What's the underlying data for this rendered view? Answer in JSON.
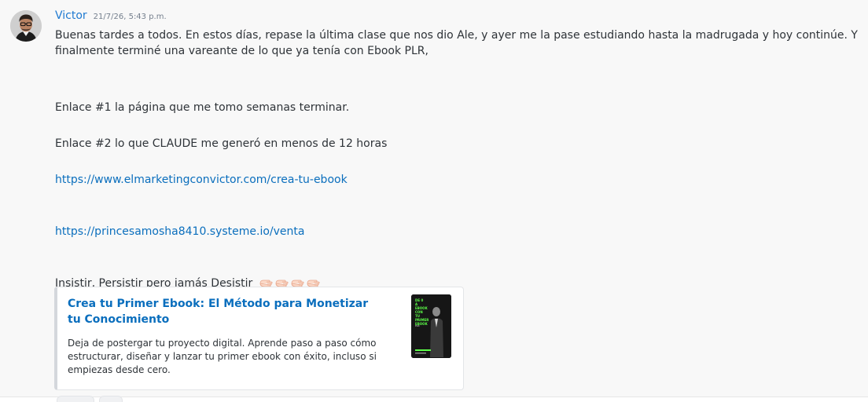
{
  "message": {
    "author": "Victor",
    "timestamp": "21/7/26, 5:43 p.m.",
    "avatar_icon": "user-avatar-photo",
    "paragraph1": "Buenas tardes a todos. En estos días, repase la última clase que nos dio Ale, y ayer me la pase estudiando hasta la  madrugada y hoy continúe. Y",
    "paragraph1_cont": "finalmente terminé una vareante de lo que ya tenía con Ebook PLR,",
    "link1_text": "Enlace #1 la página que me tomo semanas terminar.",
    "link2_text": "Enlace #2 lo que CLAUDE me generó en menos de 12 horas",
    "url1": "https://www.elmarketingconvictor.com/crea-tu-ebook",
    "url2": "https://princesamosha8410.systeme.io/venta",
    "closing": "Insistir, Persistir pero jamás Desistir",
    "emoji_icon": "pointing-hand-icon"
  },
  "embed": {
    "title": "Crea tu Primer Ebook: El Método para Monetizar tu Conocimiento",
    "description": "Deja de postergar tu proyecto digital. Aprende paso a paso cómo estructurar, diseñar y lanzar tu primer ebook con éxito, incluso si empiezas desde cero.",
    "thumbnail_lines": [
      "DE 0 A",
      "EBOOK",
      "CON TU",
      "PRIMER",
      "EBOOK"
    ],
    "thumbnail_sub": "PLR"
  },
  "colors": {
    "author": "#1f7ad1",
    "link": "#0a6ebd",
    "text": "#2e3338",
    "thumbnail_accent": "#5cff48"
  }
}
